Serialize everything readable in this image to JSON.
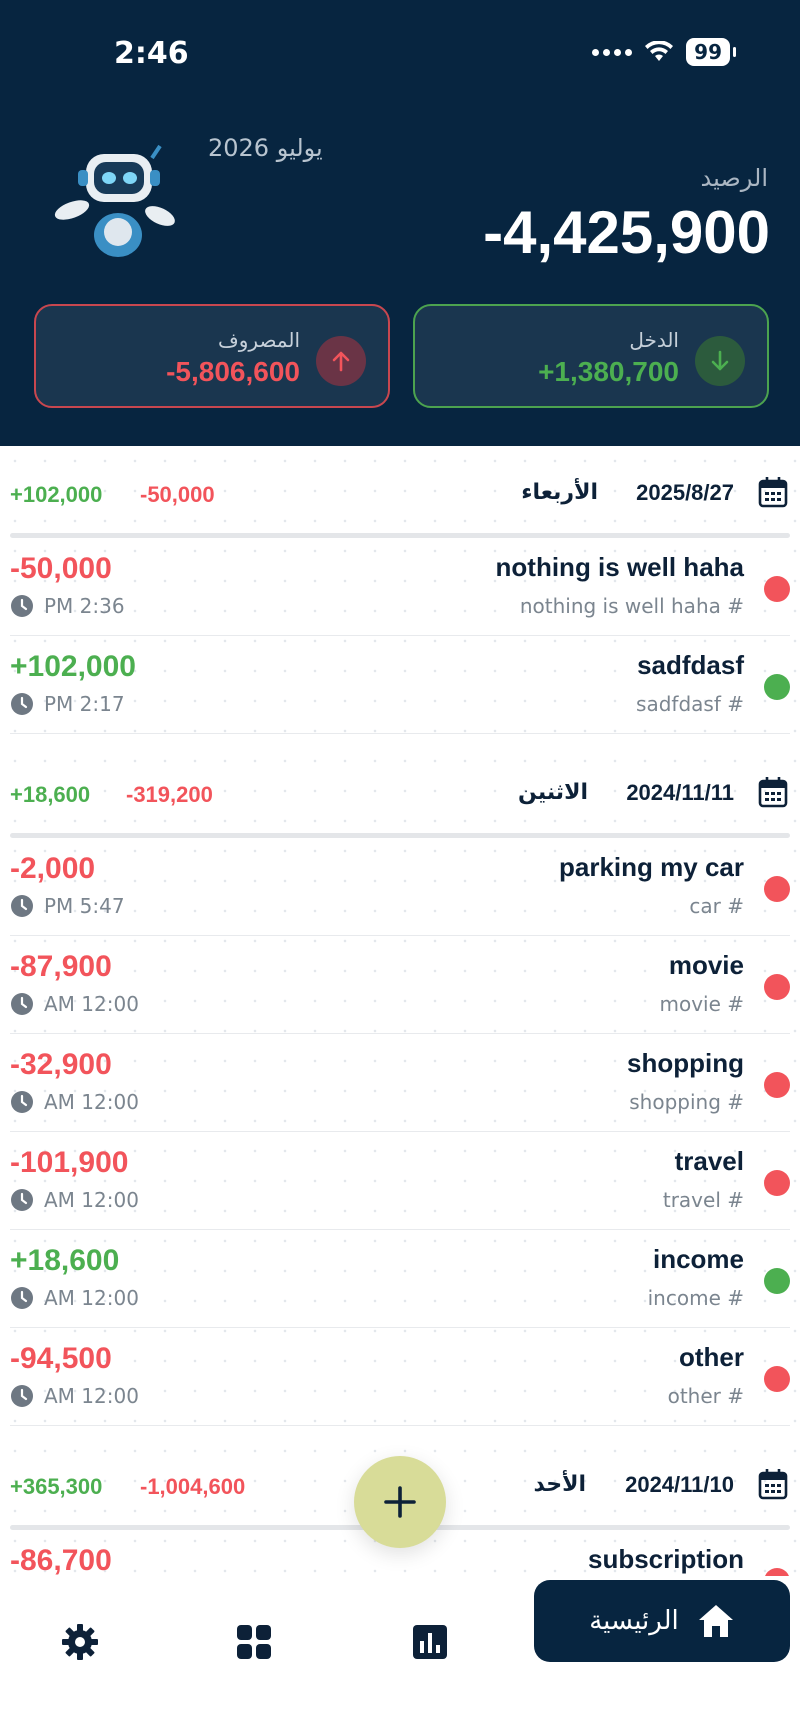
{
  "status_bar": {
    "time": "2:46",
    "battery": "99"
  },
  "header": {
    "month": "يوليو 2026",
    "balance_label": "الرصيد",
    "balance_value": "-4,425,900",
    "expense": {
      "label": "المصروف",
      "value": "-5,806,600"
    },
    "income": {
      "label": "الدخل",
      "value": "+1,380,700"
    }
  },
  "groups": [
    {
      "date": "2025/8/27",
      "day": "الأربعاء",
      "income_total": "+102,000",
      "expense_total": "-50,000",
      "transactions": [
        {
          "title": "nothing is well haha",
          "tag": "nothing is well haha #",
          "amount": "-50,000",
          "time": "PM 2:36",
          "type": "expense"
        },
        {
          "title": "sadfdasf",
          "tag": "sadfdasf #",
          "amount": "+102,000",
          "time": "PM 2:17",
          "type": "income"
        }
      ]
    },
    {
      "date": "2024/11/11",
      "day": "الاثنين",
      "income_total": "+18,600",
      "expense_total": "-319,200",
      "transactions": [
        {
          "title": "parking my car",
          "tag": "car #",
          "amount": "-2,000",
          "time": "PM 5:47",
          "type": "expense"
        },
        {
          "title": "movie",
          "tag": "movie #",
          "amount": "-87,900",
          "time": "AM 12:00",
          "type": "expense"
        },
        {
          "title": "shopping",
          "tag": "shopping #",
          "amount": "-32,900",
          "time": "AM 12:00",
          "type": "expense"
        },
        {
          "title": "travel",
          "tag": "travel #",
          "amount": "-101,900",
          "time": "AM 12:00",
          "type": "expense"
        },
        {
          "title": "income",
          "tag": "income #",
          "amount": "+18,600",
          "time": "AM 12:00",
          "type": "income"
        },
        {
          "title": "other",
          "tag": "other #",
          "amount": "-94,500",
          "time": "AM 12:00",
          "type": "expense"
        }
      ]
    },
    {
      "date": "2024/11/10",
      "day": "الأحد",
      "income_total": "+365,300",
      "expense_total": "-1,004,600",
      "transactions": [
        {
          "title": "subscription",
          "tag": "",
          "amount": "-86,700",
          "time": "",
          "type": "expense"
        }
      ]
    }
  ],
  "nav": {
    "home_label": "الرئيسية"
  },
  "colors": {
    "header_bg": "#072540",
    "income": "#4caf50",
    "expense": "#f2545b",
    "fab": "#d8dc98"
  },
  "icons": [
    "robot-mascot",
    "arrow-up-icon",
    "arrow-down-icon",
    "calendar-icon",
    "clock-icon",
    "plus-icon",
    "gear-icon",
    "grid-icon",
    "chart-icon",
    "home-icon"
  ]
}
